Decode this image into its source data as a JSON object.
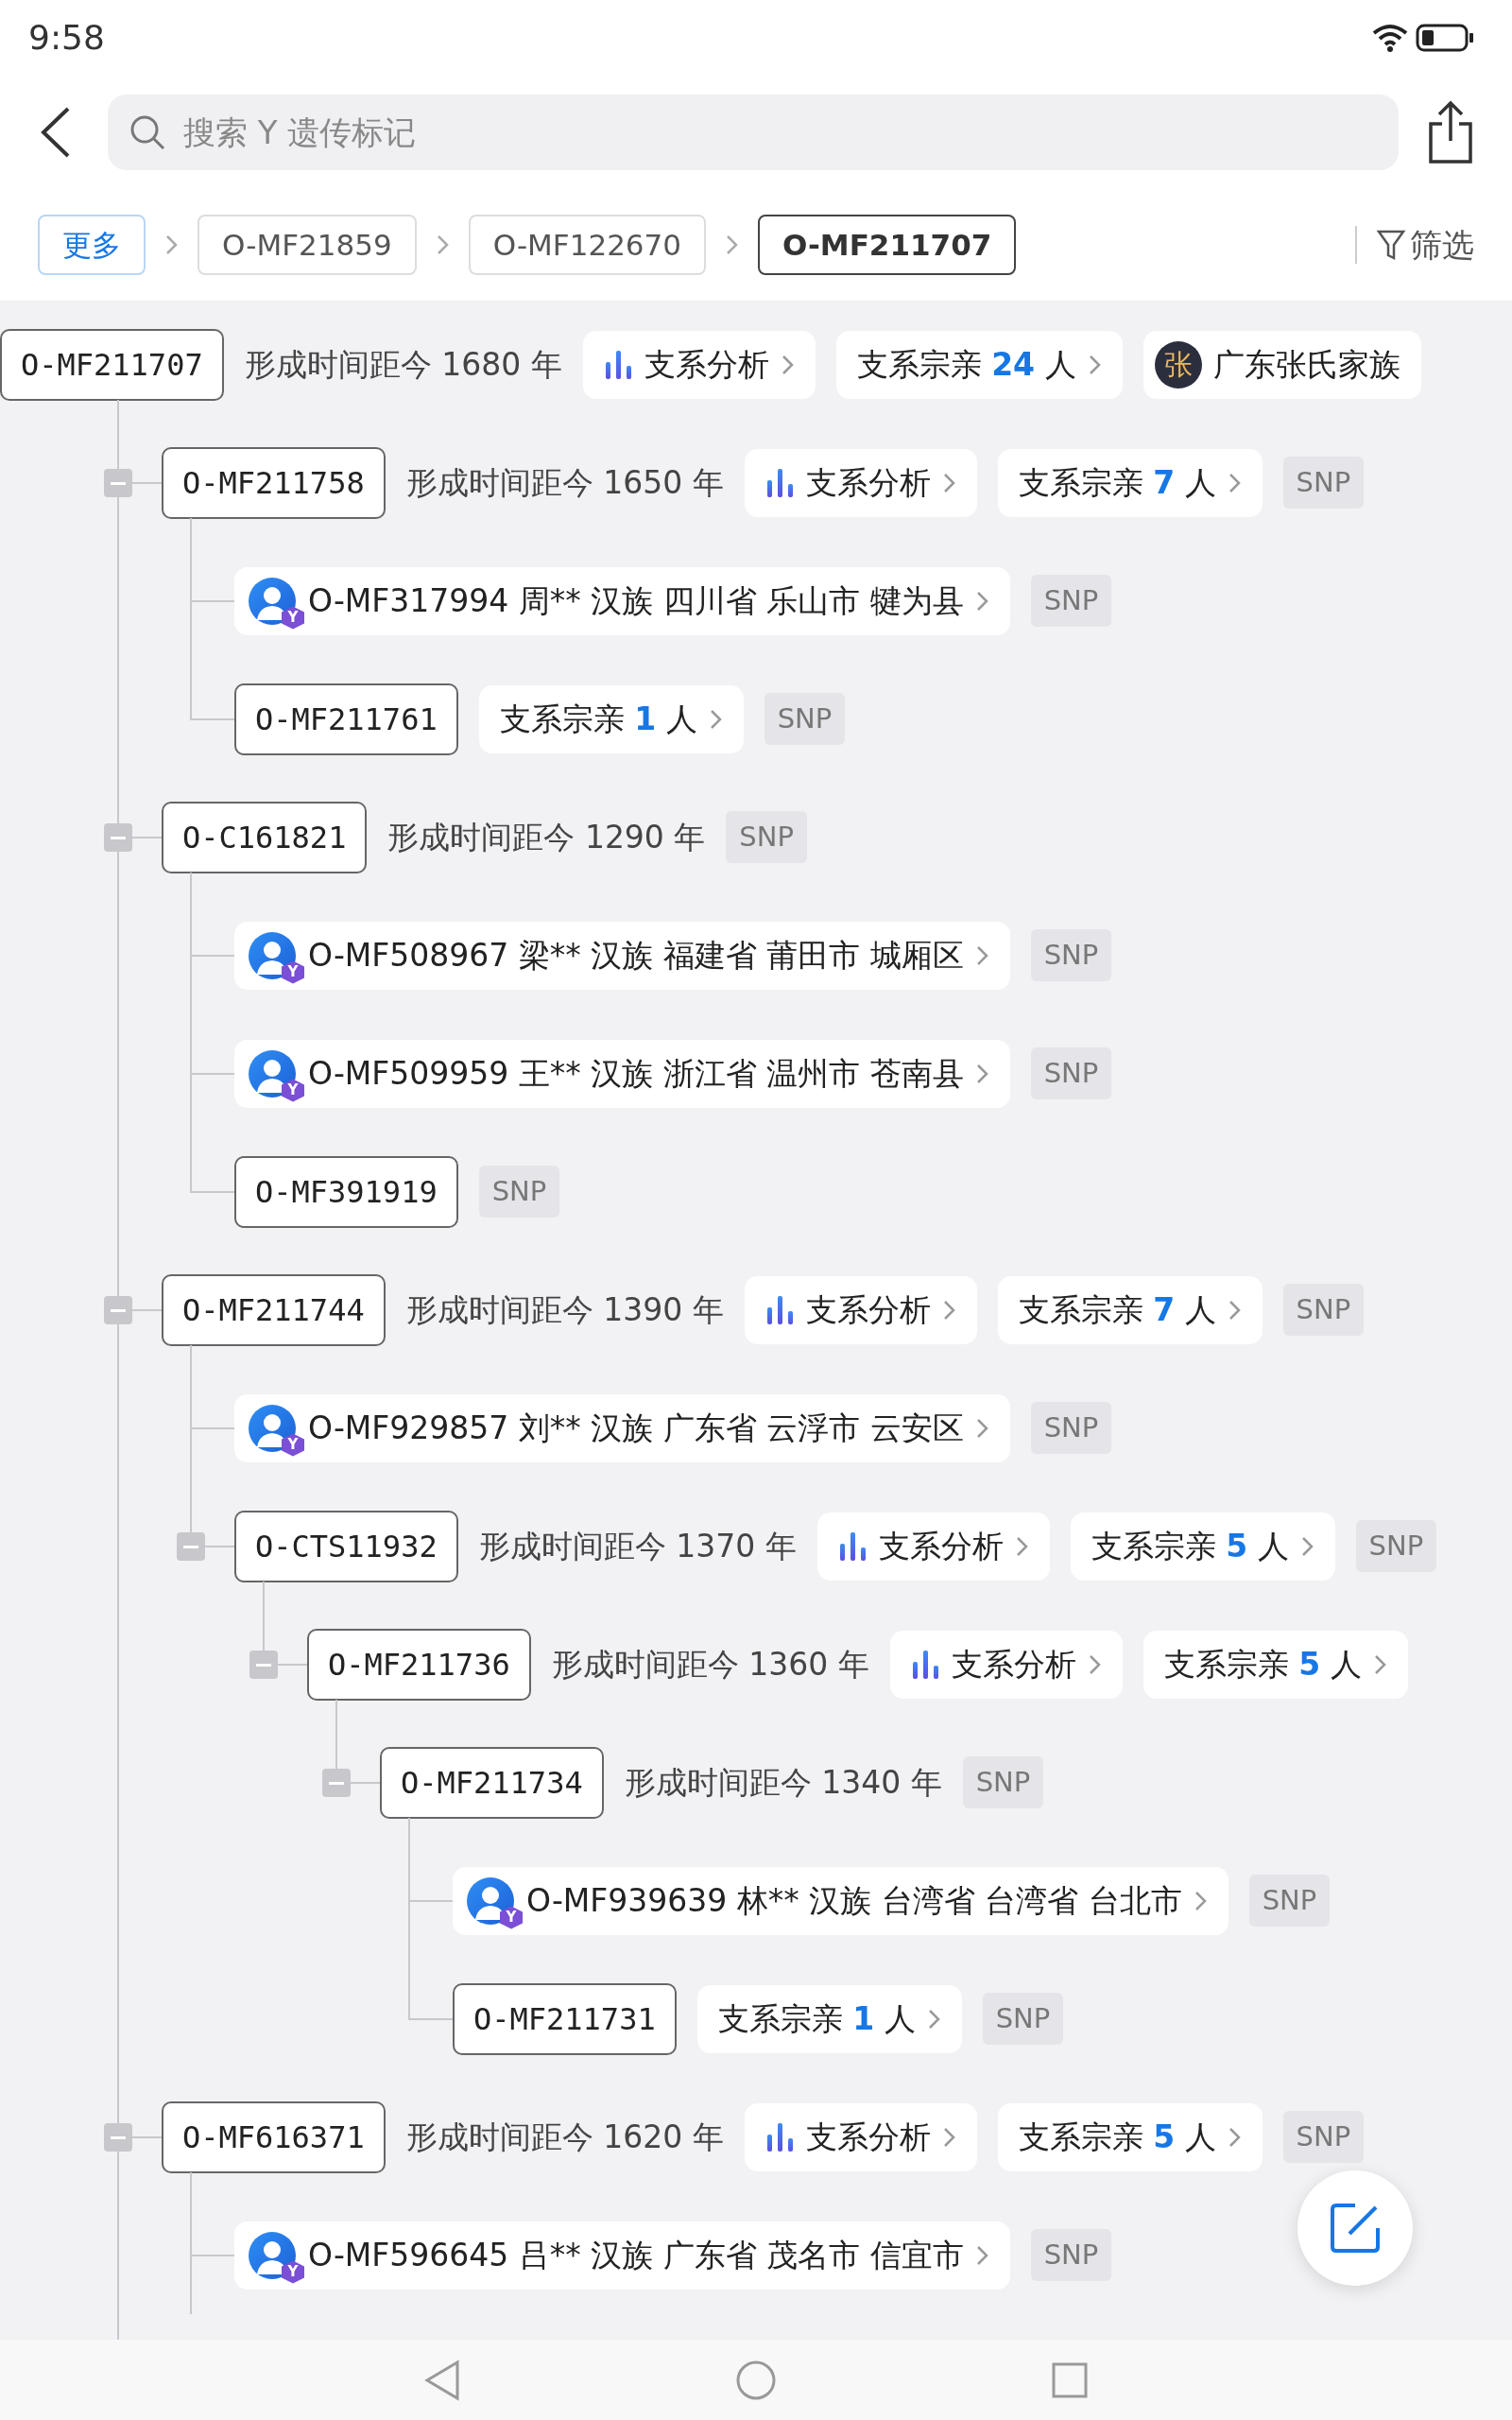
{
  "status_bar": {
    "time": "9:58"
  },
  "search": {
    "placeholder": "搜索 Y 遗传标记"
  },
  "breadcrumbs": [
    {
      "kind": "more",
      "label": "更多",
      "selected": false
    },
    {
      "kind": "node",
      "label": "O-MF21859",
      "selected": false
    },
    {
      "kind": "node",
      "label": "O-MF122670",
      "selected": false
    },
    {
      "kind": "node",
      "label": "O-MF211707",
      "selected": true
    }
  ],
  "filter": {
    "label": "筛选"
  },
  "tree": {
    "kind": "group",
    "id": "O-MF211707",
    "age": "形成时间距今 1680 年",
    "analysis": "支系分析",
    "relatives": {
      "label": "支系宗亲",
      "count": "24",
      "unit": "人"
    },
    "family": {
      "mark": "张",
      "name": "广东张氏家族"
    },
    "children": [
      {
        "kind": "group",
        "id": "O-MF211758",
        "expanded": true,
        "age": "形成时间距今 1650 年",
        "analysis": "支系分析",
        "relatives": {
          "label": "支系宗亲",
          "count": "7",
          "unit": "人"
        },
        "snp": "SNP",
        "children": [
          {
            "kind": "person",
            "label": "O-MF317994 周** 汉族 四川省 乐山市 犍为县",
            "badge": "Y",
            "snp": "SNP"
          },
          {
            "kind": "group",
            "id": "O-MF211761",
            "relatives": {
              "label": "支系宗亲",
              "count": "1",
              "unit": "人"
            },
            "snp": "SNP"
          }
        ]
      },
      {
        "kind": "group",
        "id": "O-C161821",
        "expanded": true,
        "age": "形成时间距今 1290 年",
        "snp": "SNP",
        "children": [
          {
            "kind": "person",
            "label": "O-MF508967 梁** 汉族 福建省 莆田市 城厢区",
            "badge": "Y",
            "snp": "SNP"
          },
          {
            "kind": "person",
            "label": "O-MF509959 王** 汉族 浙江省 温州市 苍南县",
            "badge": "Y",
            "snp": "SNP"
          },
          {
            "kind": "group",
            "id": "O-MF391919",
            "snp": "SNP"
          }
        ]
      },
      {
        "kind": "group",
        "id": "O-MF211744",
        "expanded": true,
        "age": "形成时间距今 1390 年",
        "analysis": "支系分析",
        "relatives": {
          "label": "支系宗亲",
          "count": "7",
          "unit": "人"
        },
        "snp": "SNP",
        "children": [
          {
            "kind": "person",
            "label": "O-MF929857 刘** 汉族 广东省 云浮市 云安区",
            "badge": "Y",
            "snp": "SNP"
          },
          {
            "kind": "group",
            "id": "O-CTS11932",
            "expanded": true,
            "age": "形成时间距今 1370 年",
            "analysis": "支系分析",
            "relatives": {
              "label": "支系宗亲",
              "count": "5",
              "unit": "人"
            },
            "snp": "SNP",
            "children": [
              {
                "kind": "group",
                "id": "O-MF211736",
                "expanded": true,
                "age": "形成时间距今 1360 年",
                "analysis": "支系分析",
                "relatives": {
                  "label": "支系宗亲",
                  "count": "5",
                  "unit": "人"
                },
                "children": [
                  {
                    "kind": "group",
                    "id": "O-MF211734",
                    "expanded": true,
                    "age": "形成时间距今 1340 年",
                    "snp": "SNP",
                    "children": [
                      {
                        "kind": "person",
                        "label": "O-MF939639 林** 汉族 台湾省 台湾省 台北市",
                        "badge": "Y",
                        "snp": "SNP"
                      },
                      {
                        "kind": "group",
                        "id": "O-MF211731",
                        "relatives": {
                          "label": "支系宗亲",
                          "count": "1",
                          "unit": "人"
                        },
                        "snp": "SNP"
                      }
                    ]
                  }
                ]
              }
            ]
          }
        ]
      },
      {
        "kind": "group",
        "id": "O-MF616371",
        "expanded": true,
        "age": "形成时间距今 1620 年",
        "analysis": "支系分析",
        "relatives": {
          "label": "支系宗亲",
          "count": "5",
          "unit": "人"
        },
        "snp": "SNP",
        "children": [
          {
            "kind": "person",
            "label": "O-MF596645 吕** 汉族 广东省 茂名市 信宜市",
            "badge": "Y",
            "snp": "SNP"
          }
        ]
      }
    ]
  }
}
